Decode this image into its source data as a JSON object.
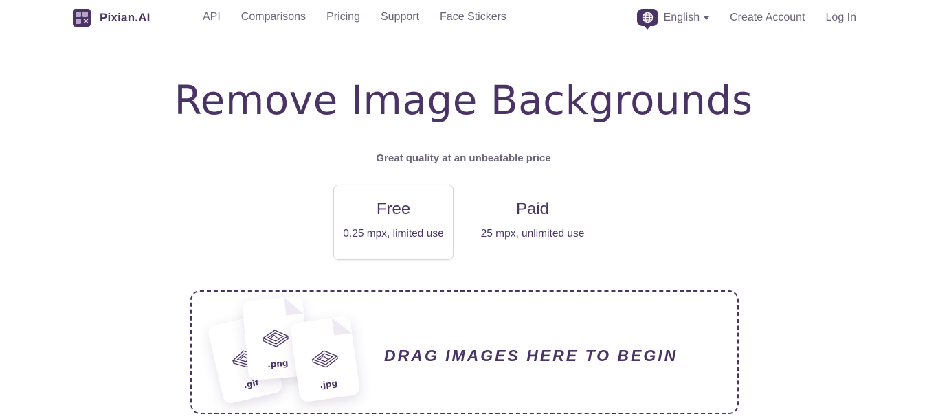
{
  "brand": {
    "name": "Pixian.AI"
  },
  "nav": {
    "links": [
      "API",
      "Comparisons",
      "Pricing",
      "Support",
      "Face Stickers"
    ],
    "language": "English",
    "create_account": "Create Account",
    "log_in": "Log In"
  },
  "hero": {
    "title": "Remove Image Backgrounds",
    "subtitle": "Great quality at an unbeatable price"
  },
  "plans": [
    {
      "name": "Free",
      "desc": "0.25 mpx, limited use",
      "selected": true
    },
    {
      "name": "Paid",
      "desc": "25 mpx, unlimited use",
      "selected": false
    }
  ],
  "dropzone": {
    "label": "DRAG IMAGES HERE TO BEGIN",
    "file_types": [
      ".gif",
      ".png",
      ".jpg"
    ]
  },
  "colors": {
    "brand": "#4a3466",
    "text_muted": "#6b6478",
    "border": "#d9d3e0"
  },
  "icons": [
    "logo-icon",
    "globe-icon",
    "caret-down-icon",
    "image-file-icon"
  ]
}
